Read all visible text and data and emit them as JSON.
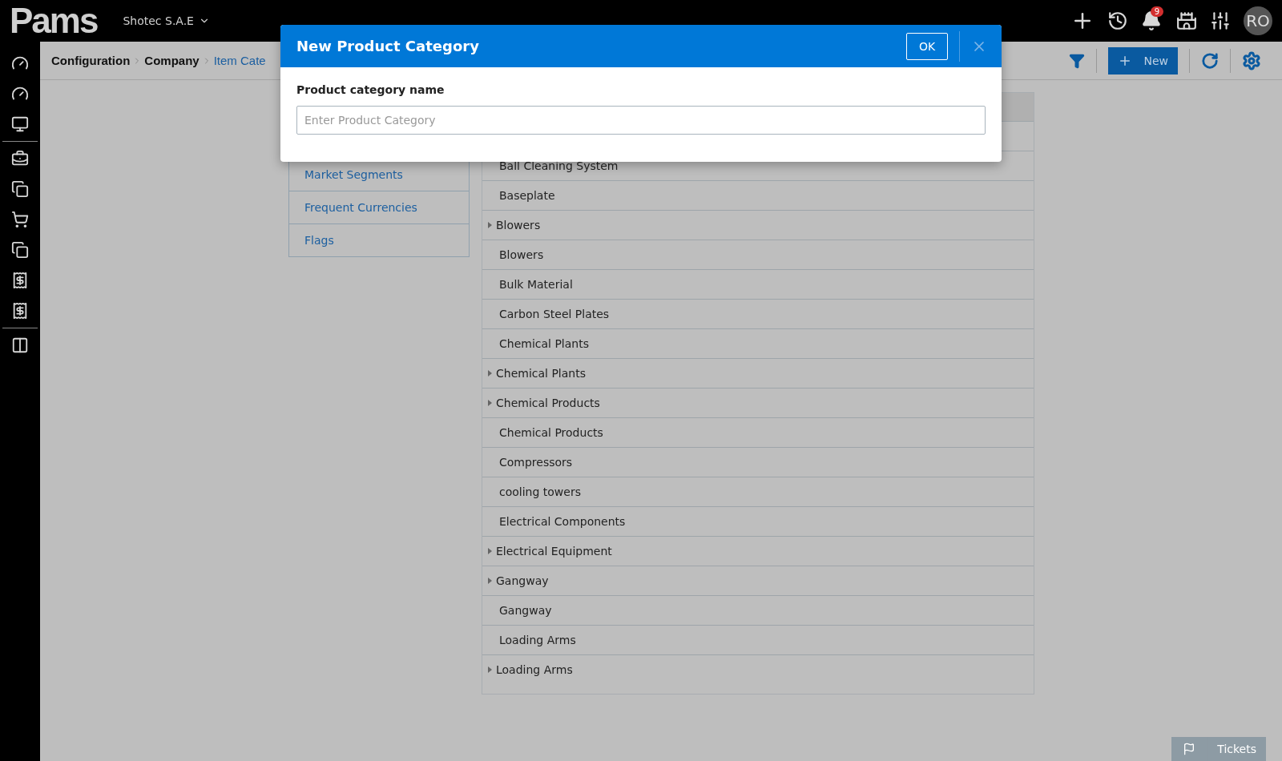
{
  "topbar": {
    "logo": "Pams",
    "company": "Shotec S.A.E",
    "notifications_badge": "9",
    "avatar": "RO"
  },
  "breadcrumb": [
    {
      "label": "Configuration",
      "kind": "crumb"
    },
    {
      "label": "Company",
      "kind": "crumb"
    },
    {
      "label": "Item Cate",
      "kind": "link"
    }
  ],
  "toolbar": {
    "new_button": "New"
  },
  "settings_nav": [
    {
      "label": "Market Segments"
    },
    {
      "label": "Frequent Currencies"
    },
    {
      "label": "Flags"
    }
  ],
  "categories": [
    {
      "name": "Ball Cleaning System",
      "expandable": false
    },
    {
      "name": "Baseplate",
      "expandable": false
    },
    {
      "name": "Blowers",
      "expandable": true
    },
    {
      "name": "Blowers",
      "expandable": false
    },
    {
      "name": "Bulk Material",
      "expandable": false
    },
    {
      "name": "Carbon Steel Plates",
      "expandable": false
    },
    {
      "name": "Chemical Plants",
      "expandable": false
    },
    {
      "name": "Chemical Plants",
      "expandable": true
    },
    {
      "name": "Chemical Products",
      "expandable": true
    },
    {
      "name": "Chemical Products",
      "expandable": false
    },
    {
      "name": "Compressors",
      "expandable": false
    },
    {
      "name": "cooling towers",
      "expandable": false
    },
    {
      "name": "Electrical Components",
      "expandable": false
    },
    {
      "name": "Electrical Equipment",
      "expandable": true
    },
    {
      "name": "Gangway",
      "expandable": true
    },
    {
      "name": "Gangway",
      "expandable": false
    },
    {
      "name": "Loading Arms",
      "expandable": false
    },
    {
      "name": "Loading Arms",
      "expandable": true
    }
  ],
  "modal": {
    "title": "New Product Category",
    "ok_button": "OK",
    "field_label": "Product category name",
    "placeholder": "Enter Product Category"
  },
  "tickets_button": "Tickets"
}
